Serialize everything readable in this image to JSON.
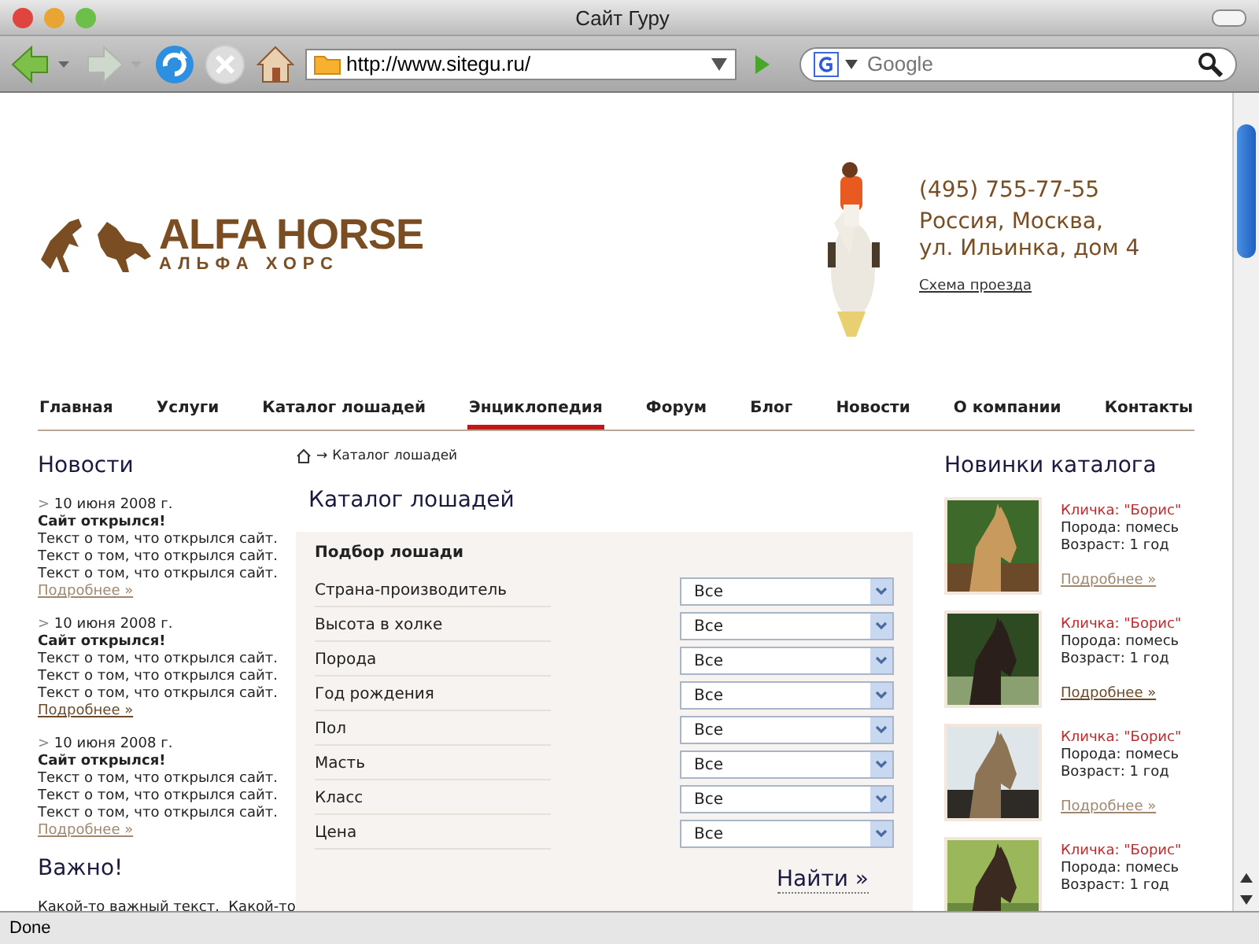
{
  "window": {
    "title": "Сайт Гуру"
  },
  "toolbar": {
    "url": "http://www.sitegu.ru/",
    "search_placeholder": "Google"
  },
  "header": {
    "logo_title": "ALFA HORSE",
    "logo_subtitle": "АЛЬФА ХОРС",
    "phone": "(495) 755-77-55",
    "address_lines": [
      "Россия, Москва,",
      "ул. Ильинка, дом 4"
    ],
    "map_link": "Схема проезда"
  },
  "nav": [
    {
      "label": "Главная",
      "selected": false
    },
    {
      "label": "Услуги",
      "selected": false
    },
    {
      "label": "Каталог лошадей",
      "selected": false
    },
    {
      "label": "Энциклопедия",
      "selected": true
    },
    {
      "label": "Форум",
      "selected": false
    },
    {
      "label": "Блог",
      "selected": false
    },
    {
      "label": "Новости",
      "selected": false
    },
    {
      "label": "О компании",
      "selected": false
    },
    {
      "label": "Контакты",
      "selected": false
    }
  ],
  "news": {
    "title": "Новости",
    "items": [
      {
        "marker": ">",
        "date": "10 июня 2008 г.",
        "headline": "Сайт открылся!",
        "lines": [
          "Текст о том, что открылся сайт.",
          "Текст о том, что открылся сайт.",
          "Текст о том, что открылся сайт."
        ],
        "more": "Подробнее »",
        "hovered": false
      },
      {
        "marker": ">",
        "date": "10 июня 2008 г.",
        "headline": "Сайт открылся!",
        "lines": [
          "Текст о том, что открылся сайт.",
          "Текст о том, что открылся сайт.",
          "Текст о том, что открылся сайт."
        ],
        "more": "Подробнее »",
        "hovered": true
      },
      {
        "marker": ">",
        "date": "10 июня 2008 г.",
        "headline": "Сайт открылся!",
        "lines": [
          "Текст о том, что открылся сайт.",
          "Текст о том, что открылся сайт.",
          "Текст о том, что открылся сайт."
        ],
        "more": "Подробнее »",
        "hovered": false
      }
    ]
  },
  "important": {
    "title": "Важно!",
    "text": "Какой-то важный текст.  Какой-то"
  },
  "breadcrumb": {
    "separator": "→",
    "current": "Каталог лошадей"
  },
  "catalog": {
    "title": "Каталог лошадей",
    "filter_title": "Подбор лошади",
    "filters": [
      {
        "label": "Страна-производитель",
        "value": "Все"
      },
      {
        "label": "Высота в холке",
        "value": "Все"
      },
      {
        "label": "Порода",
        "value": "Все"
      },
      {
        "label": "Год рождения",
        "value": "Все"
      },
      {
        "label": "Пол",
        "value": "Все"
      },
      {
        "label": "Масть",
        "value": "Все"
      },
      {
        "label": "Класс",
        "value": "Все"
      },
      {
        "label": "Цена",
        "value": "Все"
      }
    ],
    "submit": "Найти »"
  },
  "new_items": {
    "title": "Новинки каталога",
    "items": [
      {
        "name": "Кличка: \"Борис\"",
        "breed": "Порода: помесь",
        "age": "Возраст:  1 год",
        "more": "Подробнее »",
        "hovered": false
      },
      {
        "name": "Кличка: \"Борис\"",
        "breed": "Порода: помесь",
        "age": "Возраст:  1 год",
        "more": "Подробнее »",
        "hovered": true
      },
      {
        "name": "Кличка: \"Борис\"",
        "breed": "Порода: помесь",
        "age": "Возраст:  1 год",
        "more": "Подробнее »",
        "hovered": false
      },
      {
        "name": "Кличка: \"Борис\"",
        "breed": "Порода: помесь",
        "age": "Возраст:  1 год"
      }
    ]
  },
  "status_bar": {
    "text": "Done"
  }
}
